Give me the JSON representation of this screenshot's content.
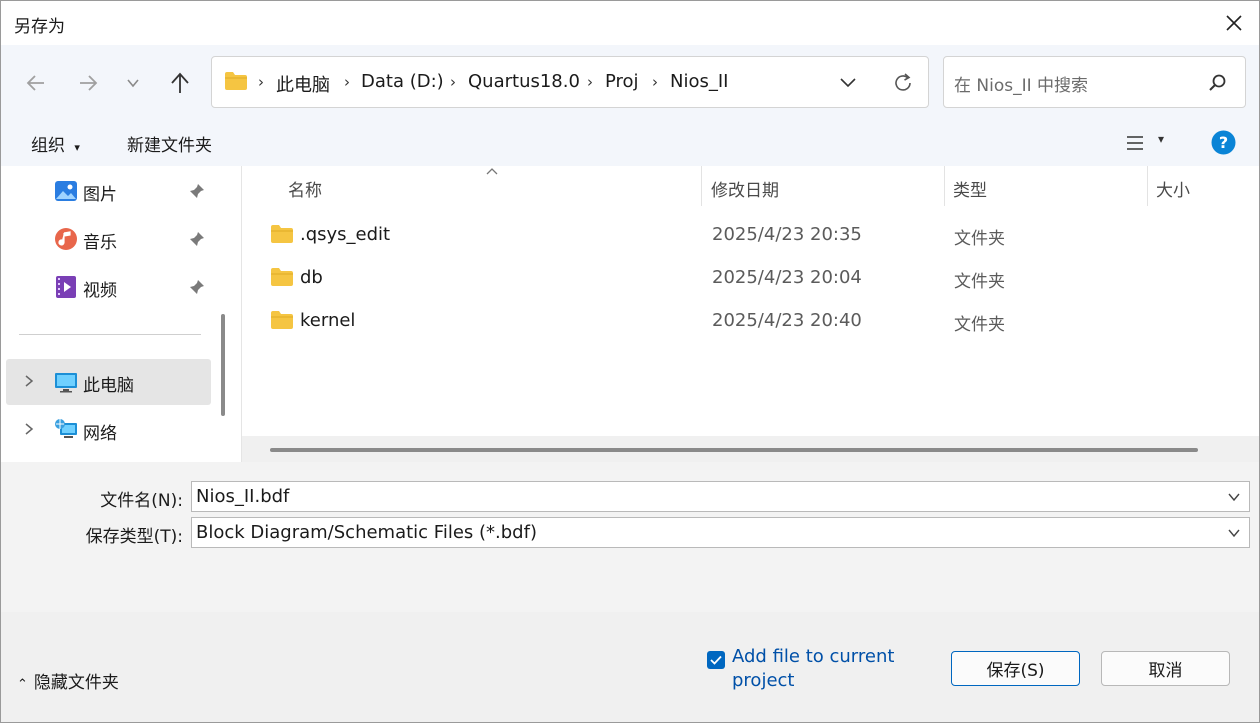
{
  "window": {
    "title": "另存为"
  },
  "nav": {
    "breadcrumbs": [
      "此电脑",
      "Data (D:)",
      "Quartus18.0",
      "Proj",
      "Nios_II"
    ],
    "search_placeholder": "在 Nios_II 中搜索"
  },
  "toolbar": {
    "organize_label": "组织",
    "new_folder_label": "新建文件夹"
  },
  "sidebar": {
    "items": [
      {
        "label": "图片",
        "icon": "pictures-icon",
        "pinned": true
      },
      {
        "label": "音乐",
        "icon": "music-icon",
        "pinned": true
      },
      {
        "label": "视频",
        "icon": "videos-icon",
        "pinned": true
      },
      {
        "label": "此电脑",
        "icon": "this-pc-icon",
        "selected": true
      },
      {
        "label": "网络",
        "icon": "network-icon"
      }
    ]
  },
  "filelist": {
    "columns": [
      "名称",
      "修改日期",
      "类型",
      "大小"
    ],
    "rows": [
      {
        "name": ".qsys_edit",
        "date": "2025/4/23 20:35",
        "type": "文件夹",
        "size": ""
      },
      {
        "name": "db",
        "date": "2025/4/23 20:04",
        "type": "文件夹",
        "size": ""
      },
      {
        "name": "kernel",
        "date": "2025/4/23 20:40",
        "type": "文件夹",
        "size": ""
      }
    ]
  },
  "form": {
    "filename_label": "文件名(N):",
    "filename_value": "Nios_II.bdf",
    "filetype_label": "保存类型(T):",
    "filetype_value": "Block Diagram/Schematic Files (*.bdf)"
  },
  "footer": {
    "hide_folders_label": "隐藏文件夹",
    "add_file_label": "Add file to current project",
    "add_file_checked": true,
    "save_label": "保存(S)",
    "cancel_label": "取消"
  },
  "colors": {
    "accent": "#0067c0",
    "folder": "#f5c542",
    "help": "#0a84d6"
  }
}
